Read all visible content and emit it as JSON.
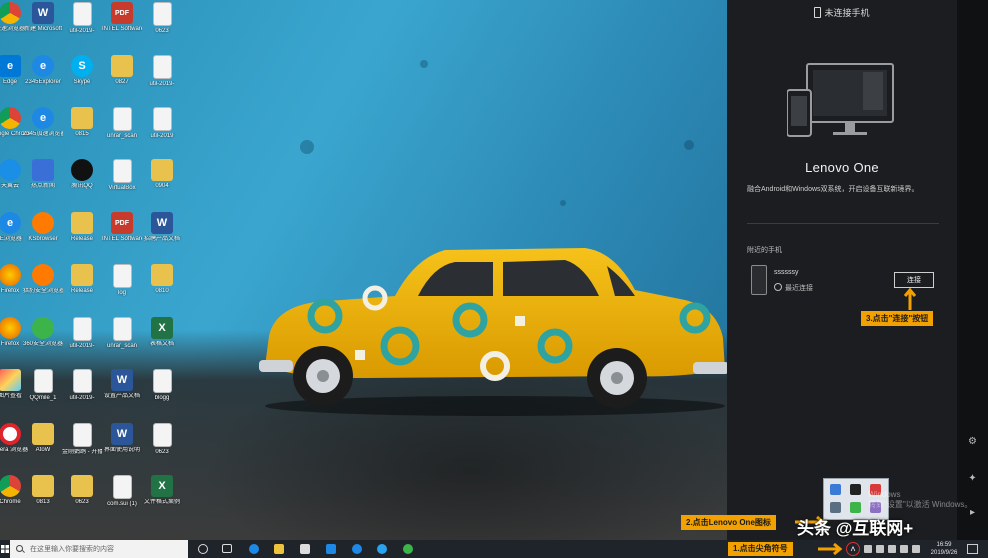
{
  "desktop": {
    "icons": [
      {
        "label": "极速浏览器",
        "icon": "chrome-icon"
      },
      {
        "label": "新建 Microsoft",
        "icon": "word-icon"
      },
      {
        "label": "util-2019-",
        "icon": "file-icon"
      },
      {
        "label": "INTEL Software",
        "icon": "pdf-icon"
      },
      {
        "label": "0623",
        "icon": "file-icon"
      },
      {
        "label": "Edge",
        "icon": "edge-icon"
      },
      {
        "label": "2345Explorer",
        "icon": "ie-icon"
      },
      {
        "label": "Skype",
        "icon": "skype-icon"
      },
      {
        "label": "0827",
        "icon": "folder-icon"
      },
      {
        "label": "util-2019-",
        "icon": "file-icon"
      },
      {
        "label": "Google Chrome",
        "icon": "chrome-icon"
      },
      {
        "label": "2345加速浏览器",
        "icon": "ie-icon"
      },
      {
        "label": "0815",
        "icon": "folder-icon"
      },
      {
        "label": "unrar_scan",
        "icon": "file-icon"
      },
      {
        "label": "util-2019",
        "icon": "file-icon"
      },
      {
        "label": "天翼云",
        "icon": "cloud-icon"
      },
      {
        "label": "热点新闻",
        "icon": "setup-icon"
      },
      {
        "label": "腾讯QQ",
        "icon": "qq-icon"
      },
      {
        "label": "VirtualBox",
        "icon": "file-icon"
      },
      {
        "label": "0904",
        "icon": "folder-icon"
      },
      {
        "label": "IE浏览器",
        "icon": "ie-icon"
      },
      {
        "label": "KSbrowser",
        "icon": "orange-icon"
      },
      {
        "label": "Release",
        "icon": "folder-icon"
      },
      {
        "label": "INTEL Software",
        "icon": "pdf-icon"
      },
      {
        "label": "招聘产品文档",
        "icon": "word-icon"
      },
      {
        "label": "Firefox",
        "icon": "firefox-icon"
      },
      {
        "label": "猎豹安全浏览器",
        "icon": "orange-icon"
      },
      {
        "label": "Release",
        "icon": "folder-icon"
      },
      {
        "label": "log",
        "icon": "file-icon"
      },
      {
        "label": "0810",
        "icon": "folder-icon"
      },
      {
        "label": "Firefox",
        "icon": "firefox-icon"
      },
      {
        "label": "360安全浏览器",
        "icon": "green-icon"
      },
      {
        "label": "util-2019-",
        "icon": "file-icon"
      },
      {
        "label": "unrar_scan",
        "icon": "file-icon"
      },
      {
        "label": "表格文档",
        "icon": "excel-icon"
      },
      {
        "label": "图片查看",
        "icon": "photo-icon"
      },
      {
        "label": "QQmile_1",
        "icon": "file-icon"
      },
      {
        "label": "util-2019-",
        "icon": "file-icon"
      },
      {
        "label": "设置产品文档",
        "icon": "word-icon"
      },
      {
        "label": "blogg",
        "icon": "file-icon"
      },
      {
        "label": "Opera 浏览器",
        "icon": "opera-icon"
      },
      {
        "label": "AtoW",
        "icon": "folder-icon"
      },
      {
        "label": "金刚鹦鹉 - 开播音频",
        "icon": "file-icon"
      },
      {
        "label": "界面使用说明",
        "icon": "word-icon"
      },
      {
        "label": "0623",
        "icon": "file-icon"
      },
      {
        "label": "Chrome",
        "icon": "chrome-icon"
      },
      {
        "label": "0813",
        "icon": "folder-icon"
      },
      {
        "label": "0623",
        "icon": "folder-icon"
      },
      {
        "label": "com.sui (1)",
        "icon": "file-icon"
      },
      {
        "label": "文件格式案例",
        "icon": "excel-icon"
      }
    ]
  },
  "lenovo_panel": {
    "status": "未连接手机",
    "title": "Lenovo One",
    "description": "融合Android和Windows双系统，开启设备互联新境界。",
    "nearby_label": "附近的手机",
    "device_name": "ssssssy",
    "device_status": "最近连接",
    "connect_button": "连接"
  },
  "annotations": {
    "step1": "1.点击尖角符号",
    "step2": "2.点击Lenovo One图标",
    "step3": "3.点击\"连接\"按钮"
  },
  "watermark": "Windows\n转到\"设置\"以激活 Windows。",
  "taskbar": {
    "search_placeholder": "在这里输入你要搜索的内容",
    "time": "16:59",
    "date": "2019/9/26"
  },
  "brand": "头条 @互联网+",
  "colors": {
    "annotation": "#f2a100",
    "panel_bg": "#1b1d20",
    "taskbar_bg": "#1f232a",
    "car_yellow": "#f2b705",
    "car_teal": "#2ea3a1"
  }
}
